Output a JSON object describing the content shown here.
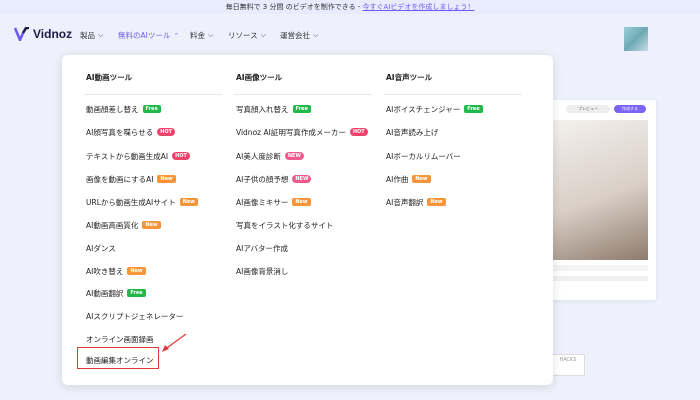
{
  "topbar": {
    "text": "毎日無料で 3 分間 のビデオを制作できる - ",
    "cta": "今すぐAIビデオを作成しましょう！"
  },
  "brand": {
    "name": "Vidnoz",
    "color": "#6c5cf2"
  },
  "nav": {
    "items": [
      "製品",
      "無料のAIツール",
      "料金",
      "リソース",
      "運営会社"
    ]
  },
  "menu": {
    "columns": [
      {
        "title": "AI動画ツール",
        "items": [
          {
            "label": "動画顔差し替え",
            "badge": "Free"
          },
          {
            "label": "AI顔写真を喋らせる",
            "badge": "HOT"
          },
          {
            "label": "テキストから動画生成AI",
            "badge": "HOT"
          },
          {
            "label": "画像を動画にするAI",
            "badge": "New"
          },
          {
            "label": "URLから動画生成AIサイト",
            "badge": "New"
          },
          {
            "label": "AI動画高画質化",
            "badge": "New"
          },
          {
            "label": "AIダンス",
            "badge": ""
          },
          {
            "label": "AI吹き替え",
            "badge": "New"
          },
          {
            "label": "AI動画翻訳",
            "badge": "Free"
          },
          {
            "label": "AIスクリプトジェネレーター",
            "badge": ""
          },
          {
            "label": "オンライン画面録画",
            "badge": ""
          },
          {
            "label": "動画編集オンライン",
            "badge": ""
          }
        ]
      },
      {
        "title": "AI画像ツール",
        "items": [
          {
            "label": "写真顔入れ替え",
            "badge": "Free"
          },
          {
            "label": "Vidnoz AI証明写真作成メーカー",
            "badge": "HOT"
          },
          {
            "label": "AI美人度診断",
            "badge": "NEW"
          },
          {
            "label": "AI子供の顔予想",
            "badge": "NEW"
          },
          {
            "label": "AI画像ミキサー",
            "badge": "New"
          },
          {
            "label": "写真をイラスト化するサイト",
            "badge": ""
          },
          {
            "label": "AIアバター作成",
            "badge": ""
          },
          {
            "label": "AI画像背景消し",
            "badge": ""
          }
        ]
      },
      {
        "title": "AI音声ツール",
        "items": [
          {
            "label": "AIボイスチェンジャー",
            "badge": "Free"
          },
          {
            "label": "AI音声読み上げ",
            "badge": ""
          },
          {
            "label": "AIボーカルリムーバー",
            "badge": ""
          },
          {
            "label": "AI作曲",
            "badge": "New"
          },
          {
            "label": "AI音声翻訳",
            "badge": "New"
          }
        ]
      }
    ]
  },
  "background": {
    "pill_left": "プレビュー",
    "pill_right": "作成する",
    "badge": "HACKS"
  },
  "colors": {
    "free": "#1fba4a",
    "hot": "#f0436b",
    "new": "#f7953b",
    "highlight": "#e03b3b"
  }
}
